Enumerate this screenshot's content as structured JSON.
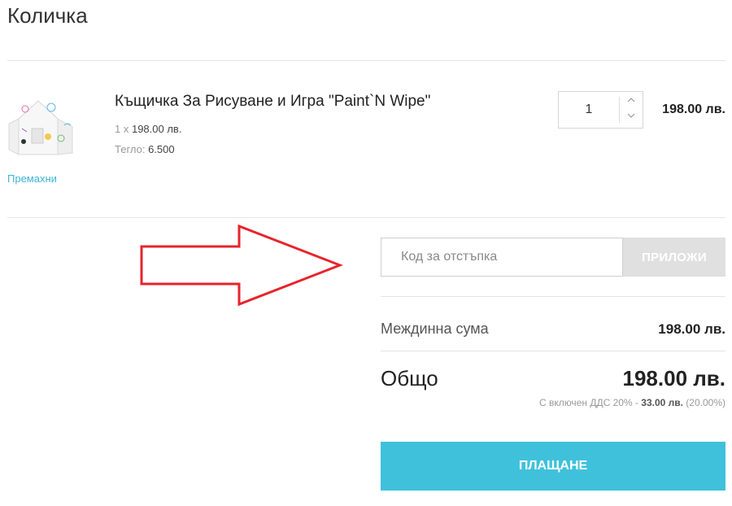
{
  "page": {
    "title": "Количка"
  },
  "cart": {
    "item": {
      "name": "Къщичка За Рисуване и Игра \"Paint`N Wipe\"",
      "unit_prefix": "1 x ",
      "unit_price": "198.00 лв.",
      "weight_label": "Тегло: ",
      "weight_value": "6.500",
      "remove_label": "Премахни",
      "quantity": "1",
      "line_total": "198.00 лв."
    },
    "coupon": {
      "placeholder": "Код за отстъпка",
      "apply_label": "ПРИЛОЖИ"
    },
    "summary": {
      "subtotal_label": "Междинна сума",
      "subtotal_value": "198.00 лв.",
      "total_label": "Общо",
      "total_value": "198.00 лв.",
      "vat_prefix": "С включен ДДС 20% - ",
      "vat_amount": "33.00 лв.",
      "vat_suffix": " (20.00%)"
    },
    "checkout_label": "ПЛАЩАНЕ"
  },
  "colors": {
    "accent": "#3fc1db",
    "link": "#3bb4d3",
    "arrow": "#e8232b",
    "apply_bg": "#e0e0e0"
  }
}
